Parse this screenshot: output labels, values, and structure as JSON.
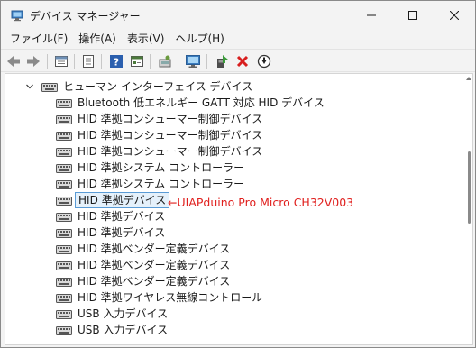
{
  "window": {
    "title": "デバイス マネージャー"
  },
  "menu": [
    {
      "label": "ファイル(F)"
    },
    {
      "label": "操作(A)"
    },
    {
      "label": "表示(V)"
    },
    {
      "label": "ヘルプ(H)"
    }
  ],
  "toolbar": {
    "icons": [
      "back-icon",
      "forward-icon",
      "properties-icon",
      "view-icon",
      "help-icon",
      "action-icon",
      "scan-hardware-icon",
      "monitor-icon",
      "update-driver-icon",
      "uninstall-icon",
      "disable-icon"
    ]
  },
  "tree": {
    "category": "ヒューマン インターフェイス デバイス",
    "devices": [
      "Bluetooth 低エネルギー GATT 対応 HID デバイス",
      "HID 準拠コンシューマー制御デバイス",
      "HID 準拠コンシューマー制御デバイス",
      "HID 準拠コンシューマー制御デバイス",
      "HID 準拠システム コントローラー",
      "HID 準拠システム コントローラー",
      "HID 準拠デバイス",
      "HID 準拠デバイス",
      "HID 準拠デバイス",
      "HID 準拠ベンダー定義デバイス",
      "HID 準拠ベンダー定義デバイス",
      "HID 準拠ベンダー定義デバイス",
      "HID 準拠ワイヤレス無線コントロール",
      "USB 入力デバイス",
      "USB 入力デバイス"
    ],
    "selected_index": 6
  },
  "annotation": "←UIAPduino Pro Micro CH32V003",
  "colors": {
    "selection_border": "#5a9bd5",
    "selection_fill": "#e5f1fb",
    "annotation": "#e0201e"
  }
}
